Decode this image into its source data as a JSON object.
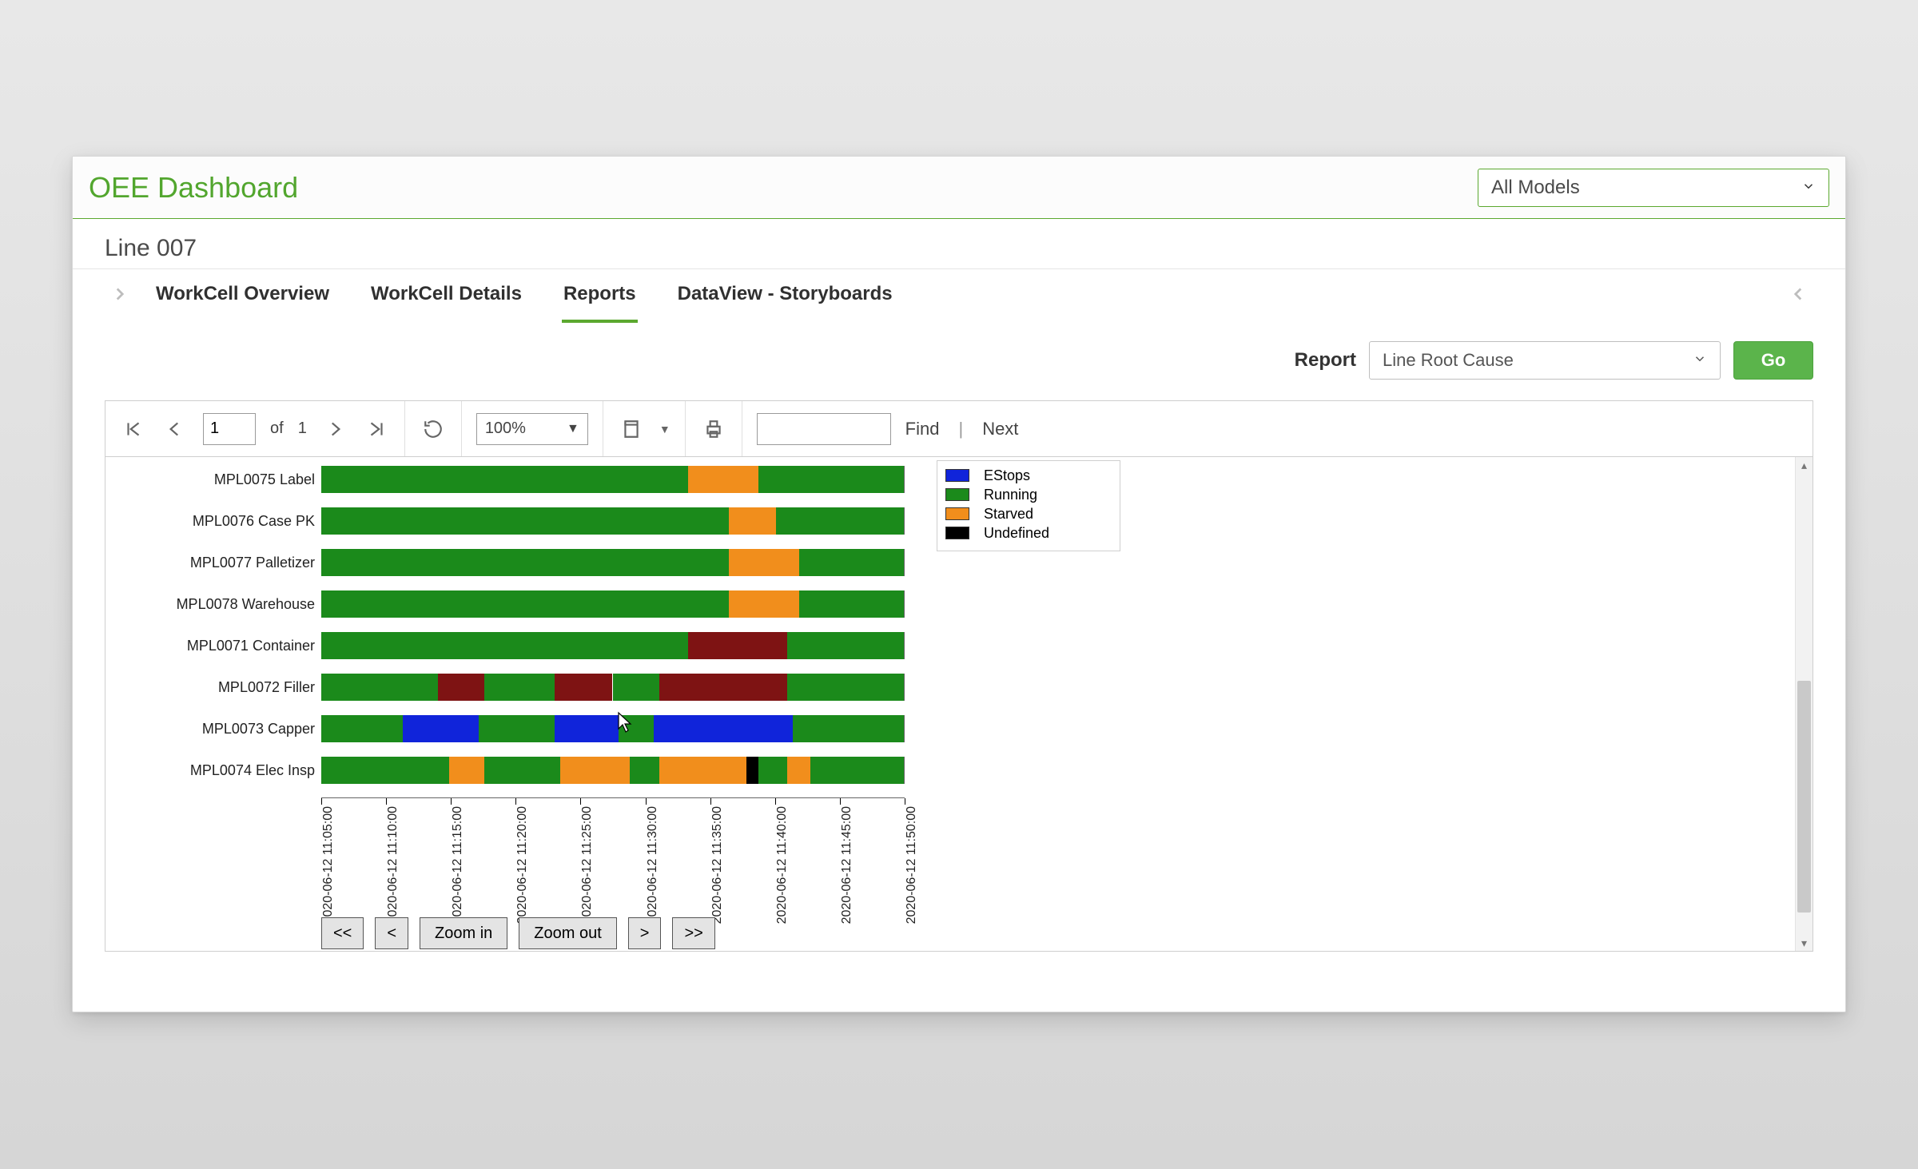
{
  "header": {
    "title": "OEE Dashboard",
    "model_selected": "All Models"
  },
  "line_label": "Line 007",
  "tabs": {
    "items": [
      {
        "id": "overview",
        "label": "WorkCell Overview"
      },
      {
        "id": "details",
        "label": "WorkCell Details"
      },
      {
        "id": "reports",
        "label": "Reports"
      },
      {
        "id": "dataview",
        "label": "DataView - Storyboards"
      }
    ],
    "active": "reports"
  },
  "report_picker": {
    "label": "Report",
    "selected": "Line Root Cause",
    "go": "Go"
  },
  "toolbar": {
    "page_value": "1",
    "page_of": "of",
    "page_total": "1",
    "zoom": "100%",
    "find": "Find",
    "next": "Next"
  },
  "chart_data": {
    "type": "gantt",
    "x_ticks": [
      "2020-06-12 11:05:00",
      "2020-06-12 11:10:00",
      "2020-06-12 11:15:00",
      "2020-06-12 11:20:00",
      "2020-06-12 11:25:00",
      "2020-06-12 11:30:00",
      "2020-06-12 11:35:00",
      "2020-06-12 11:40:00",
      "2020-06-12 11:45:00",
      "2020-06-12 11:50:00"
    ],
    "legend": [
      {
        "name": "EStops",
        "color": "#1024da"
      },
      {
        "name": "Running",
        "color": "#1b8a1b"
      },
      {
        "name": "Starved",
        "color": "#f18e1c"
      },
      {
        "name": "Undefined",
        "color": "#000000"
      }
    ],
    "rows": [
      {
        "label": "MPL0075 Label",
        "segments": [
          {
            "state": "running",
            "start": 0,
            "end": 63
          },
          {
            "state": "starved",
            "start": 63,
            "end": 75
          },
          {
            "state": "running",
            "start": 75,
            "end": 100
          }
        ]
      },
      {
        "label": "MPL0076 Case PK",
        "segments": [
          {
            "state": "running",
            "start": 0,
            "end": 70
          },
          {
            "state": "starved",
            "start": 70,
            "end": 78
          },
          {
            "state": "running",
            "start": 78,
            "end": 100
          }
        ]
      },
      {
        "label": "MPL0077 Palletizer",
        "segments": [
          {
            "state": "running",
            "start": 0,
            "end": 70
          },
          {
            "state": "starved",
            "start": 70,
            "end": 82
          },
          {
            "state": "running",
            "start": 82,
            "end": 100
          }
        ]
      },
      {
        "label": "MPL0078 Warehouse",
        "segments": [
          {
            "state": "running",
            "start": 0,
            "end": 70
          },
          {
            "state": "starved",
            "start": 70,
            "end": 82
          },
          {
            "state": "running",
            "start": 82,
            "end": 100
          }
        ]
      },
      {
        "label": "MPL0071 Container",
        "segments": [
          {
            "state": "running",
            "start": 0,
            "end": 63
          },
          {
            "state": "fault",
            "start": 63,
            "end": 80
          },
          {
            "state": "running",
            "start": 80,
            "end": 100
          }
        ]
      },
      {
        "label": "MPL0072 Filler",
        "segments": [
          {
            "state": "running",
            "start": 0,
            "end": 20
          },
          {
            "state": "fault",
            "start": 20,
            "end": 28
          },
          {
            "state": "running",
            "start": 28,
            "end": 40
          },
          {
            "state": "fault",
            "start": 40,
            "end": 50
          },
          {
            "state": "running",
            "start": 50,
            "end": 58
          },
          {
            "state": "fault",
            "start": 58,
            "end": 80
          },
          {
            "state": "running",
            "start": 80,
            "end": 100
          }
        ]
      },
      {
        "label": "MPL0073 Capper",
        "segments": [
          {
            "state": "running",
            "start": 0,
            "end": 14
          },
          {
            "state": "estops",
            "start": 14,
            "end": 27
          },
          {
            "state": "running",
            "start": 27,
            "end": 40
          },
          {
            "state": "estops",
            "start": 40,
            "end": 51
          },
          {
            "state": "running",
            "start": 51,
            "end": 57
          },
          {
            "state": "estops",
            "start": 57,
            "end": 81
          },
          {
            "state": "running",
            "start": 81,
            "end": 100
          }
        ]
      },
      {
        "label": "MPL0074 Elec Insp",
        "segments": [
          {
            "state": "running",
            "start": 0,
            "end": 22
          },
          {
            "state": "starved",
            "start": 22,
            "end": 28
          },
          {
            "state": "running",
            "start": 28,
            "end": 41
          },
          {
            "state": "starved",
            "start": 41,
            "end": 53
          },
          {
            "state": "running",
            "start": 53,
            "end": 58
          },
          {
            "state": "starved",
            "start": 58,
            "end": 73
          },
          {
            "state": "undefined",
            "start": 73,
            "end": 75
          },
          {
            "state": "running",
            "start": 75,
            "end": 80
          },
          {
            "state": "starved",
            "start": 80,
            "end": 84
          },
          {
            "state": "running",
            "start": 84,
            "end": 100
          }
        ]
      }
    ]
  },
  "zoom_buttons": {
    "first": "<<",
    "prev": "<",
    "zin": "Zoom in",
    "zout": "Zoom out",
    "next": ">",
    "last": ">>"
  }
}
